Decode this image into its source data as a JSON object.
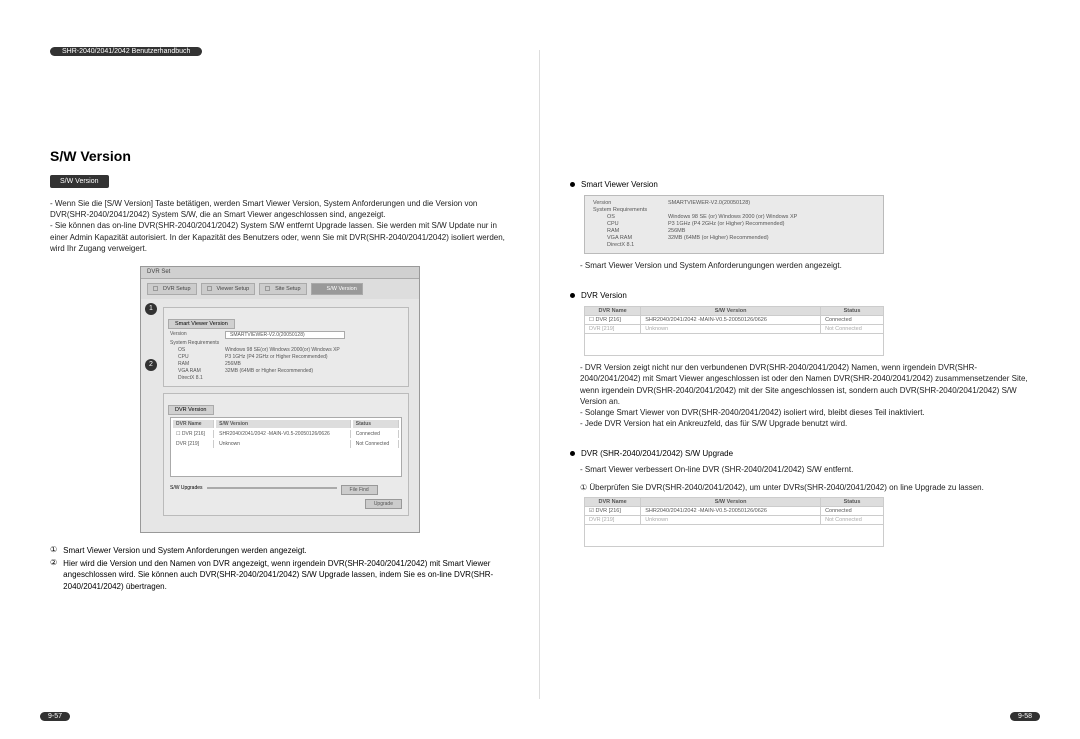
{
  "header": {
    "title": "SHR-2040/2041/2042 Benutzerhandbuch"
  },
  "left": {
    "sectionTitle": "S/W Version",
    "tabLabel": "S/W Version",
    "para1_a": "- Wenn Sie die [S/W Version] Taste betätigen, werden Smart Viewer Version, System Anforderungen und die Version von DVR(SHR-2040/2041/2042) System S/W, die an Smart Viewer angeschlossen sind, angezeigt.",
    "para1_b": "- Sie können das on-line DVR(SHR-2040/2041/2042) System S/W entfernt Upgrade lassen. Sie werden mit S/W Update nur in einer Admin Kapazität autorisiert. In der Kapazität des Benutzers oder, wenn Sie mit DVR(SHR-2040/2041/2042) isoliert werden, wird Ihr Zugang verweigert.",
    "shot": {
      "title": "DVR Set",
      "tabs": [
        "DVR Setup",
        "Viewer Setup",
        "Site Setup",
        "S/W Version"
      ],
      "group1": {
        "title": "Smart Viewer Version",
        "versionLabel": "Version",
        "versionValue": "SMARTVIEWER-V2.0(20050128)",
        "reqLabel": "System Requirements",
        "os_k": "OS",
        "os_v": "Windows 98 SE(or) Windows 2000(or) Windows XP",
        "cpu_k": "CPU",
        "cpu_v": "P3 1GHz (P4 2GHz or Higher Recommended)",
        "ram_k": "RAM",
        "ram_v": "256MB",
        "vga_k": "VGA RAM",
        "vga_v": "32MB (64MB or Higher Recommended)",
        "dx_k": "DirectX 8.1"
      },
      "group2": {
        "title": "DVR Version",
        "cols": [
          "DVR Name",
          "S/W Version",
          "Status"
        ],
        "row1": [
          "DVR [216]",
          "SHR2040/2041/2042 -MAIN-V0.5-20050126/0626",
          "Connected"
        ],
        "row2": [
          "DVR [219]",
          "Unknown",
          "Not Connected"
        ],
        "fileLabel": "S/W Upgrades",
        "fileBtn": "File Find",
        "upgradeBtn": "Upgrade"
      },
      "badge1": "1",
      "badge2": "2"
    },
    "notes": {
      "n1": "Smart Viewer Version und System Anforderungen werden angezeigt.",
      "n2": "Hier wird die Version und den Namen von DVR angezeigt, wenn irgendein DVR(SHR-2040/2041/2042) mit Smart Viewer angeschlossen wird. Sie können auch DVR(SHR-2040/2041/2042) S/W Upgrade lassen, indem Sie es on-line DVR(SHR-2040/2041/2042) übertragen."
    },
    "pageNum": "9-57"
  },
  "right": {
    "sub1": "Smart Viewer Version",
    "panel": {
      "versionLabel": "Version",
      "versionValue": "SMARTVIEWER-V2.0(20050128)",
      "reqLabel": "System Requirements",
      "os_k": "OS",
      "os_v": "Windows 98 SE (or) Windows 2000 (or) Windows XP",
      "cpu_k": "CPU",
      "cpu_v": "P3 1GHz (P4 2GHz (or Higher) Recommended)",
      "ram_k": "RAM",
      "ram_v": "256MB",
      "vga_k": "VGA RAM",
      "vga_v": "32MB (64MB (or Higher) Recommended)",
      "dx_k": "DirectX 8.1"
    },
    "line1": "- Smart Viewer Version und System Anforderungungen werden angezeigt.",
    "sub2": "DVR Version",
    "tbl": {
      "cols": [
        "DVR Name",
        "S/W Version",
        "Status"
      ],
      "row1": [
        "DVR [216]",
        "SHR2040/2041/2042 -MAIN-V0.5-20050126/0626",
        "Connected"
      ],
      "row2": [
        "DVR [219]",
        "Unknown",
        "Not Connected"
      ]
    },
    "line2": "- DVR Version zeigt nicht nur den verbundenen DVR(SHR-2040/2041/2042) Namen, wenn irgendein DVR(SHR-2040/2041/2042) mit Smart Viewer angeschlossen ist oder den Namen DVR(SHR-2040/2041/2042) zusammensetzender Site, wenn irgendein DVR(SHR-2040/2041/2042) mit der Site angeschlossen ist, sondern auch DVR(SHR-2040/2041/2042) S/W Version an.",
    "line3": "- Solange Smart Viewer von DVR(SHR-2040/2041/2042) isoliert wird, bleibt dieses Teil inaktiviert.",
    "line4": "- Jede DVR Version hat ein Ankreuzfeld, das für S/W Upgrade benutzt wird.",
    "sub3": "DVR (SHR-2040/2041/2042) S/W Upgrade",
    "line5": "- Smart Viewer verbessert On-line DVR (SHR-2040/2041/2042) S/W entfernt.",
    "line6": "① Überprüfen Sie DVR(SHR-2040/2041/2042), um unter DVRs(SHR-2040/2041/2042) on line Upgrade zu lassen.",
    "pageNum": "9-58"
  }
}
